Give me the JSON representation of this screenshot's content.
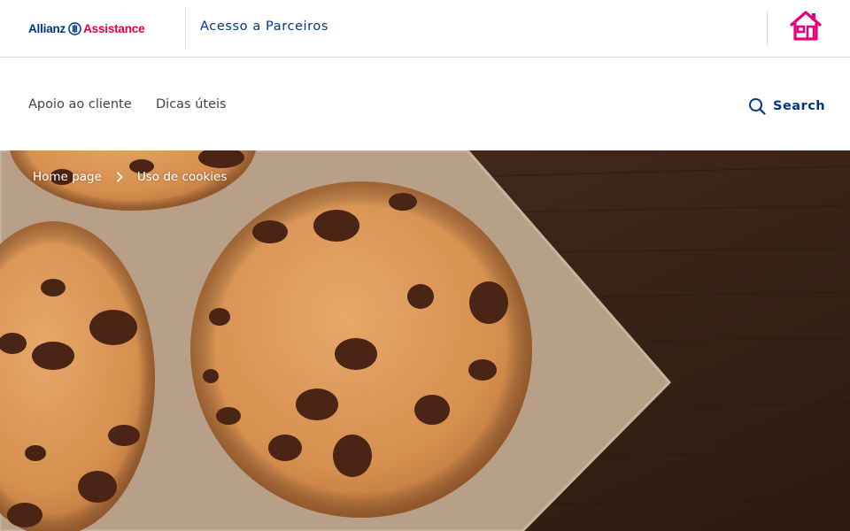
{
  "header": {
    "logo": {
      "brand": "Allianz",
      "product": "Assistance"
    },
    "partners_link": "Acesso a Parceiros",
    "home_icon": "home-icon"
  },
  "nav": {
    "items": [
      {
        "label": "Apoio ao cliente"
      },
      {
        "label": "Dicas úteis"
      }
    ],
    "search": {
      "label": "Search",
      "icon": "search-icon"
    }
  },
  "hero": {
    "breadcrumb": [
      {
        "label": "Home page"
      },
      {
        "label": "Uso de cookies"
      }
    ],
    "image": "cookies-photo"
  },
  "colors": {
    "brand_blue": "#003781",
    "brand_red": "#e4003a",
    "home_icon": "#e5007e"
  }
}
